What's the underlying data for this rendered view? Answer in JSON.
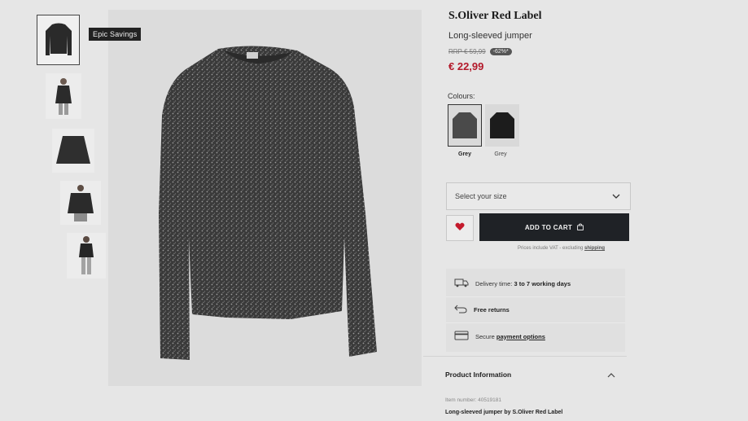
{
  "badge": "Epic Savings",
  "product": {
    "brand": "S.Oliver Red Label",
    "name": "Long-sleeved jumper",
    "rrp": "RRP € 59,99",
    "discount": "-62%*",
    "price": "€ 22,99"
  },
  "colours": {
    "label": "Colours:",
    "options": [
      {
        "label": "Grey",
        "selected": true
      },
      {
        "label": "Grey",
        "selected": false
      }
    ]
  },
  "size_select": {
    "placeholder": "Select your size"
  },
  "cart": {
    "label": "ADD TO CART"
  },
  "vat_note": {
    "text": "Prices include VAT - excluding ",
    "link": "shipping"
  },
  "services": {
    "delivery_prefix": "Delivery time: ",
    "delivery_value": "3 to 7 working days",
    "returns": "Free returns",
    "payment_prefix": "Secure ",
    "payment_link": "payment options"
  },
  "product_info": {
    "title": "Product Information",
    "item_number": "Item number: 40519181",
    "description": "Long-sleeved jumper by S.Oliver Red Label"
  },
  "colors": {
    "price": "#b3192a",
    "cart_bg": "#1f2226",
    "heart": "#c41a2c"
  },
  "icons": [
    "heart-icon",
    "bag-icon",
    "chevron-down-icon",
    "truck-icon",
    "return-arrow-icon",
    "card-icon",
    "chevron-up-icon"
  ]
}
